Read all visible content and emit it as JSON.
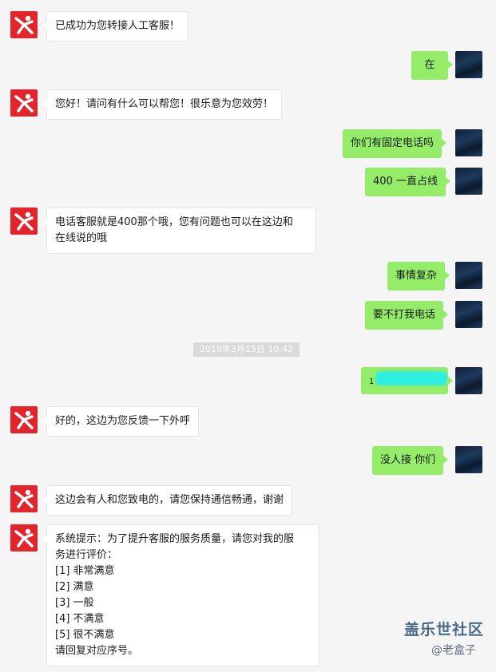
{
  "messages": [
    {
      "from": "bot",
      "text": "已成功为您转接人工客服！"
    },
    {
      "from": "user",
      "text": "在"
    },
    {
      "from": "bot",
      "text": "您好！请问有什么可以帮您！很乐意为您效劳！"
    },
    {
      "from": "user",
      "text": "你们有固定电话吗"
    },
    {
      "from": "user",
      "text": "400 一直占线"
    },
    {
      "from": "bot",
      "lines": [
        "电话客服就是400那个哦，您有问题也可以在这边和",
        "在线说的哦"
      ]
    },
    {
      "from": "user",
      "text": "事情复杂"
    },
    {
      "from": "user",
      "text": "要不打我电话"
    },
    {
      "from": "user",
      "text": "1"
    },
    {
      "from": "bot",
      "text": "好的，这边为您反馈一下外呼"
    },
    {
      "from": "user",
      "text": "没人接 你们"
    },
    {
      "from": "bot",
      "text": "这边会有人和您致电的，请您保持通信畅通，谢谢"
    },
    {
      "from": "bot",
      "lines": [
        "系统提示：为了提升客服的服务质量，请您对我的服",
        "务进行评价：",
        "[1] 非常满意",
        "[2] 满意",
        "[3] 一般",
        "[4] 不满意",
        "[5] 很不满意",
        "请回复对应序号。"
      ]
    }
  ],
  "timestamp": "2019年3月15日 10:42",
  "watermark": {
    "title": "盖乐世社区",
    "sub": "@老盒子"
  },
  "colors": {
    "user_bubble": "#95ec69",
    "bot_avatar": "#e3242b",
    "background": "#f5f5f5"
  },
  "icons": {
    "bot_avatar": "bot-logo-icon",
    "user_avatar": "user-avatar-image"
  }
}
